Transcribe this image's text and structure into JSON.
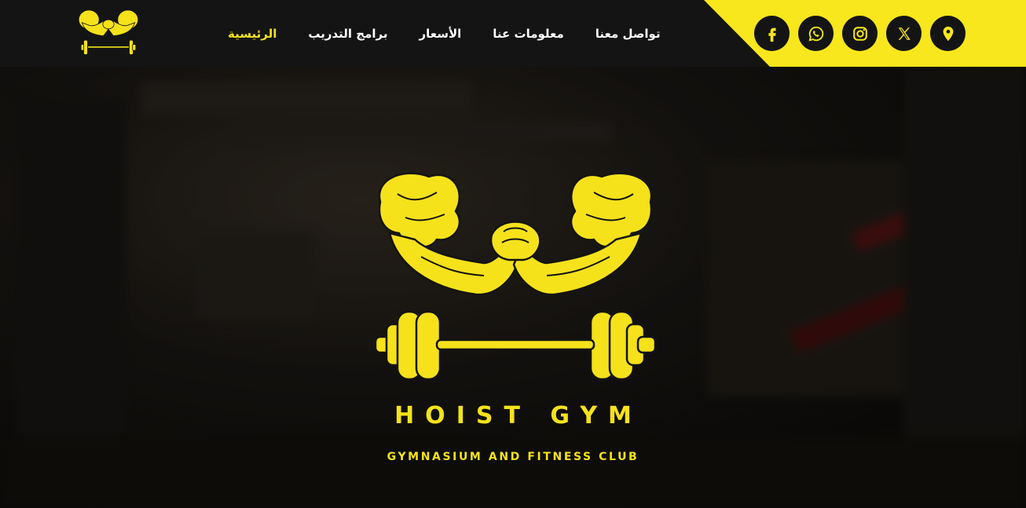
{
  "brand": {
    "title": "HOIST GYM",
    "tagline": "GYMNASIUM AND FITNESS CLUB",
    "accent_color": "#f5e21b",
    "logo_icon": "muscle-arms-barbell-logo"
  },
  "nav": {
    "items": [
      {
        "label": "الرئيسية",
        "active": true
      },
      {
        "label": "برامج التدريب",
        "active": false
      },
      {
        "label": "الأسعار",
        "active": false
      },
      {
        "label": "معلومات عنا",
        "active": false
      },
      {
        "label": "تواصل معنا",
        "active": false
      }
    ]
  },
  "social": {
    "icons": [
      "facebook-icon",
      "whatsapp-icon",
      "instagram-icon",
      "x-icon",
      "location-pin-icon"
    ],
    "band_color": "#f8e71c"
  }
}
